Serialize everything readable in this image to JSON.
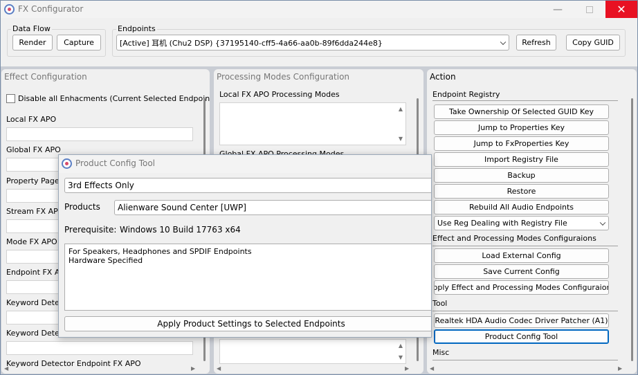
{
  "window": {
    "title": "FX Configurator"
  },
  "data_flow": {
    "label": "Data Flow",
    "render": "Render",
    "capture": "Capture"
  },
  "endpoints": {
    "label": "Endpoints",
    "selected": "[Active] 耳机 (Chu2 DSP) {37195140-cff5-4a66-aa0b-89f6dda244e8}",
    "refresh": "Refresh",
    "copy_guid": "Copy GUID"
  },
  "effect_config": {
    "title": "Effect Configuration",
    "disable_all": "Disable all Enhacments (Current Selected Endpoint)",
    "labels": [
      "Local FX APO",
      "Global FX APO",
      "Property Page",
      "Stream FX APO",
      "Mode FX APO",
      "Endpoint FX APO",
      "Keyword Detector",
      "Keyword Detector",
      "Keyword Detector Endpoint FX APO"
    ]
  },
  "processing_modes": {
    "title": "Processing Modes Configuration",
    "local_label": "Local FX APO Processing Modes",
    "global_label": "Global FX APO Processing Modes"
  },
  "action": {
    "title": "Action",
    "section_registry": "Endpoint Registry",
    "registry_buttons": [
      "Take Ownership Of Selected GUID Key",
      "Jump to Properties Key",
      "Jump to FxProperties Key",
      "Import Registry File",
      "Backup",
      "Restore",
      "Rebuild All Audio Endpoints"
    ],
    "reg_mode": "Use Reg Dealing with Registry File",
    "section_effect": "Effect and Processing Modes Configuraions",
    "effect_buttons": [
      "Load External Config",
      "Save Current Config",
      "Apply Effect and Processing Modes Configuraions"
    ],
    "section_tool": "Tool",
    "tool_buttons": [
      "Realtek HDA Audio Codec Driver Patcher (A1)",
      "Product Config Tool"
    ],
    "section_misc": "Misc"
  },
  "dialog": {
    "title": "Product Config Tool",
    "category": "3rd Effects Only",
    "products_label": "Products",
    "product": "Alienware Sound Center [UWP]",
    "prereq_label": "Prerequisite:",
    "prereq_value": "Windows 10 Build 17763 x64",
    "notes": [
      "For Speakers, Headphones and SPDIF Endpoints",
      "Hardware Specified"
    ],
    "apply": "Apply Product Settings to Selected Endpoints"
  }
}
